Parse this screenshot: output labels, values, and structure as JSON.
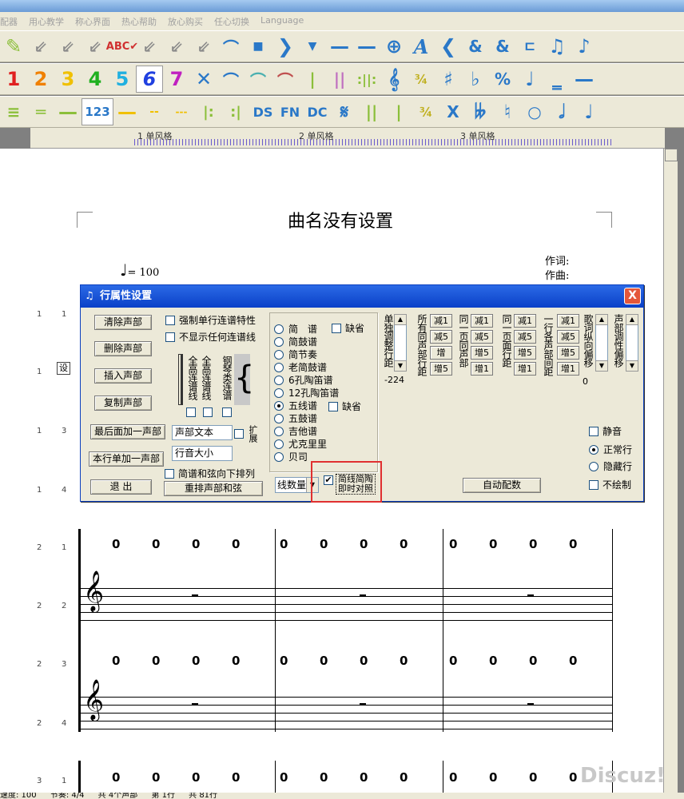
{
  "menu": {
    "items": [
      "配器",
      "用心教学",
      "称心界面",
      "热心帮助",
      "放心购买",
      "任心切换",
      "Language"
    ]
  },
  "toolbar_icons": {
    "row1": [
      "pen-icon",
      "double-arrow-icon",
      "double-arrow-icon",
      "double-arrow-icon",
      "abc-check-icon",
      "arrow-icon",
      "arrow-icon",
      "arrow-icon",
      "arc-icon",
      "dot-icon",
      "chevron-right-icon",
      "triangle-icon",
      "dash-icon",
      "long-dash-icon",
      "crosshair-icon",
      "letter-a-icon",
      "chevron-left-icon",
      "add-voice-icon",
      "remove-voice-icon",
      "bracket-icon",
      "beamed-notes-icon",
      "flag-note-icon"
    ],
    "row2_numbers": [
      "1",
      "2",
      "3",
      "4",
      "5",
      "6",
      "7"
    ],
    "row2_number_colors": [
      "#e02020",
      "#f08000",
      "#f0c000",
      "#20b020",
      "#20b0e0",
      "#2040e0",
      "#c020c0"
    ],
    "row3_label": "123"
  },
  "ruler": {
    "labels": [
      "1 单风格",
      "2 单风格",
      "3 单风格"
    ]
  },
  "score": {
    "title": "曲名没有设置",
    "tempo": "= 100",
    "lyricist": "作词:",
    "composer": "作曲:",
    "row_labels": [
      [
        "1",
        "1"
      ],
      [
        "1",
        ""
      ],
      [
        "1",
        "3"
      ],
      [
        "1",
        "4"
      ],
      [
        "2",
        "1"
      ],
      [
        "2",
        "2"
      ],
      [
        "2",
        "3"
      ],
      [
        "2",
        "4"
      ],
      [
        "3",
        "1"
      ]
    ],
    "measure_digit": "0",
    "side_button": "设"
  },
  "dialog": {
    "title": "行属性设置",
    "close": "X",
    "buttons": {
      "clear": "清除声部",
      "delete": "删除声部",
      "insert": "插入声部",
      "copy": "复制声部",
      "add_last": "最后面加一声部",
      "add_row": "本行单加一声部",
      "exit": "退 出",
      "rearrange": "重排声部和弦",
      "auto": "自动配数"
    },
    "checks": {
      "force_single": "强制单行连谱特性",
      "hide_ties": "不显示任何连谱线",
      "expand": "扩展",
      "chord_down": "简谱和弦向下排列",
      "default1": "缺省",
      "default2": "缺省",
      "realtime": "简线简陶即时对照",
      "mute": "静音",
      "hidden_row": "隐藏行",
      "no_draw": "不绘制"
    },
    "vertical_labels": {
      "full_high": "全高连谱线",
      "full_high2": "全高连谱线",
      "piano": "钢琴类连谱"
    },
    "fields": {
      "voice_text": "声部文本",
      "row_volume": "行音大小"
    },
    "notation_options": [
      "简　谱",
      "简鼓谱",
      "简节奏",
      "老简鼓谱",
      "6孔陶笛谱",
      "12孔陶笛谱",
      "五线谱",
      "五鼓谱",
      "吉他谱",
      "尤克里里",
      "贝司"
    ],
    "notation_selected": "五线谱",
    "line_count": "线数量",
    "spacing": {
      "single_label": "单独调整行距",
      "single_value": "-224",
      "all_voices": "所有同声部行距",
      "same_page_same": "同一页同声部",
      "same_page_rows": "同一页面行距",
      "row_voices": "一行各声部间距",
      "lyric_offset": "歌词纵向偏移",
      "lyric_value": "0",
      "voice_tone": "声部调性偏移",
      "dec1": "减1",
      "dec5": "减5",
      "inc": "增",
      "inc5": "增5",
      "inc1": "增1"
    },
    "row_mode": {
      "normal": "正常行",
      "selected": "正常行"
    }
  },
  "status": [
    "速度: 100",
    "节奏: 4/4",
    "共 4个声部",
    "第 1行",
    "共 81行"
  ],
  "watermark": "Discuz!"
}
